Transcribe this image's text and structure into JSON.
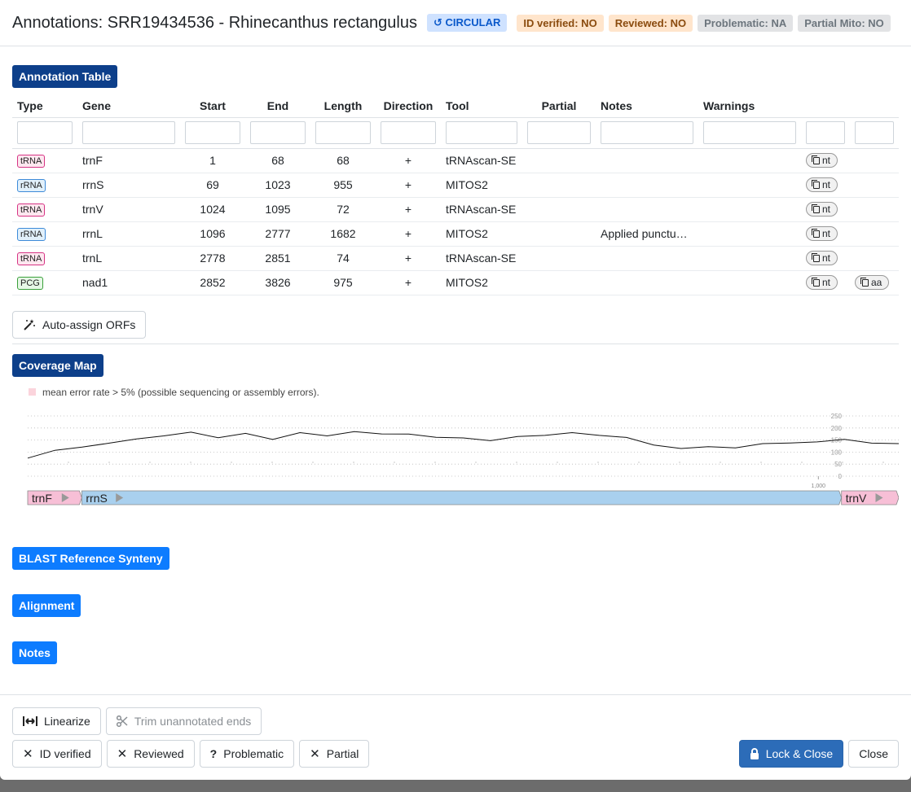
{
  "header": {
    "title": "Annotations: SRR19434536 - Rhinecanthus rectangulus",
    "circular_label": "↺ CIRCULAR",
    "badges": [
      {
        "label": "ID verified: NO"
      },
      {
        "label": "Reviewed: NO"
      },
      {
        "label": "Problematic: NA"
      },
      {
        "label": "Partial Mito: NO"
      }
    ]
  },
  "annotation_table": {
    "section_label": "Annotation Table",
    "columns": [
      "Type",
      "Gene",
      "Start",
      "End",
      "Length",
      "Direction",
      "Tool",
      "Partial",
      "Notes",
      "Warnings",
      "",
      ""
    ],
    "rows": [
      {
        "type": "tRNA",
        "gene": "trnF",
        "start": "1",
        "end": "68",
        "length": "68",
        "direction": "+",
        "tool": "tRNAscan-SE",
        "partial": "",
        "notes": "",
        "warnings": "",
        "nt": "nt",
        "aa": ""
      },
      {
        "type": "rRNA",
        "gene": "rrnS",
        "start": "69",
        "end": "1023",
        "length": "955",
        "direction": "+",
        "tool": "MITOS2",
        "partial": "",
        "notes": "",
        "warnings": "",
        "nt": "nt",
        "aa": ""
      },
      {
        "type": "tRNA",
        "gene": "trnV",
        "start": "1024",
        "end": "1095",
        "length": "72",
        "direction": "+",
        "tool": "tRNAscan-SE",
        "partial": "",
        "notes": "",
        "warnings": "",
        "nt": "nt",
        "aa": ""
      },
      {
        "type": "rRNA",
        "gene": "rrnL",
        "start": "1096",
        "end": "2777",
        "length": "1682",
        "direction": "+",
        "tool": "MITOS2",
        "partial": "",
        "notes": "Applied punctu…",
        "warnings": "",
        "nt": "nt",
        "aa": ""
      },
      {
        "type": "tRNA",
        "gene": "trnL",
        "start": "2778",
        "end": "2851",
        "length": "74",
        "direction": "+",
        "tool": "tRNAscan-SE",
        "partial": "",
        "notes": "",
        "warnings": "",
        "nt": "nt",
        "aa": ""
      },
      {
        "type": "PCG",
        "gene": "nad1",
        "start": "2852",
        "end": "3826",
        "length": "975",
        "direction": "+",
        "tool": "MITOS2",
        "partial": "",
        "notes": "",
        "warnings": "",
        "nt": "nt",
        "aa": "aa"
      }
    ]
  },
  "auto_assign_label": "Auto-assign ORFs",
  "coverage_map": {
    "section_label": "Coverage Map",
    "legend": "mean error rate > 5% (possible sequencing or assembly errors).",
    "y_ticks": [
      "250",
      "200",
      "150",
      "100",
      "50",
      "0"
    ],
    "x_tick_label": "1,000",
    "coverage_profile": [
      75,
      110,
      118,
      140,
      152,
      170,
      180,
      162,
      175,
      155,
      178,
      170,
      182,
      178,
      172,
      164,
      156,
      150,
      162,
      172,
      178,
      172,
      158,
      132,
      112,
      125,
      115,
      138,
      135,
      145,
      150,
      140,
      135
    ],
    "genes": [
      {
        "name": "trnF",
        "start": 1,
        "end": 68,
        "type": "tRNA"
      },
      {
        "name": "rrnS",
        "start": 69,
        "end": 1023,
        "type": "rRNA"
      },
      {
        "name": "trnV",
        "start": 1024,
        "end": 1095,
        "type": "tRNA"
      }
    ],
    "view_end": 1095
  },
  "collapsed_sections": [
    {
      "label": "BLAST Reference Synteny"
    },
    {
      "label": "Alignment"
    },
    {
      "label": "Notes"
    }
  ],
  "footer": {
    "linearize": "Linearize",
    "trim": "Trim unannotated ends",
    "id_verified": "ID verified",
    "reviewed": "Reviewed",
    "problematic": "Problematic",
    "partial": "Partial",
    "lock_close": "Lock & Close",
    "close": "Close"
  },
  "colors": {
    "trna_fill": "#f7bfd6",
    "rrna_fill": "#a9d0ee",
    "section_open": "#0d3f8a",
    "section_closed": "#0d7cff",
    "primary": "#2c6cb8"
  }
}
